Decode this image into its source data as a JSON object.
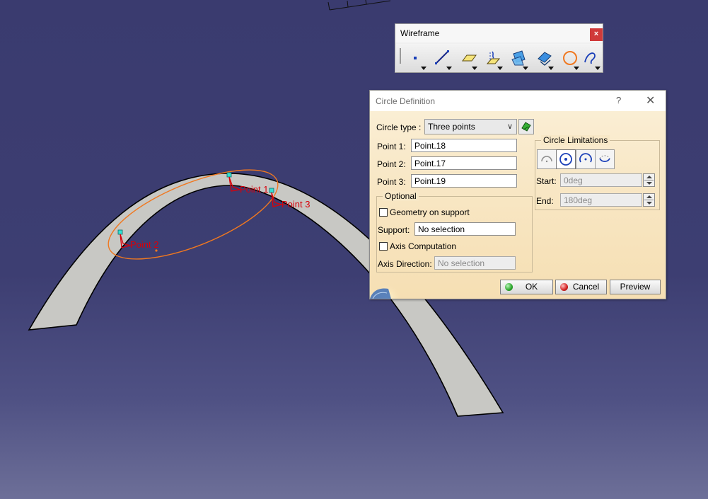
{
  "viewport": {
    "point_labels": [
      "Point 1",
      "Point 2",
      "Point 3"
    ],
    "colors": {
      "background_top": "#3a3b6f",
      "background_bottom": "#6d6f98",
      "surface_fill": "#c8c8c4",
      "circle_preview": "#f07820",
      "point_label": "#d8000a",
      "point_marker": "#35e0d2"
    }
  },
  "wireframe_toolbar": {
    "title": "Wireframe",
    "close_label": "×",
    "tools": [
      {
        "name": "point-icon"
      },
      {
        "name": "line-icon"
      },
      {
        "name": "plane-icon"
      },
      {
        "name": "projection-icon"
      },
      {
        "name": "intersection-icon"
      },
      {
        "name": "offset-icon"
      },
      {
        "name": "circle-icon"
      },
      {
        "name": "spline-icon"
      }
    ]
  },
  "circle_dialog": {
    "title": "Circle Definition",
    "help_label": "?",
    "close_label": "✕",
    "circle_type": {
      "label": "Circle type :",
      "value": "Three points"
    },
    "point1": {
      "label": "Point 1:",
      "value": "Point.18"
    },
    "point2": {
      "label": "Point 2:",
      "value": "Point.17"
    },
    "point3": {
      "label": "Point 3:",
      "value": "Point.19"
    },
    "optional": {
      "title": "Optional",
      "geometry_on_support": {
        "label": "Geometry on support",
        "checked": false
      },
      "support": {
        "label": "Support:",
        "value": "No selection"
      },
      "axis_computation": {
        "label": "Axis Computation",
        "checked": false
      },
      "axis_direction": {
        "label": "Axis Direction:",
        "placeholder": "No selection"
      }
    },
    "circle_limitations": {
      "title": "Circle Limitations",
      "modes": [
        "part-arc-icon",
        "whole-circle-icon",
        "trimmed-arc-icon",
        "complementary-arc-icon"
      ],
      "active_mode": "whole-circle-icon",
      "start": {
        "label": "Start:",
        "value": "0deg"
      },
      "end": {
        "label": "End:",
        "value": "180deg"
      }
    },
    "buttons": {
      "ok": "OK",
      "cancel": "Cancel",
      "preview": "Preview"
    },
    "colors": {
      "ok_dot": "#2aa52a",
      "cancel_dot": "#d22020"
    }
  }
}
